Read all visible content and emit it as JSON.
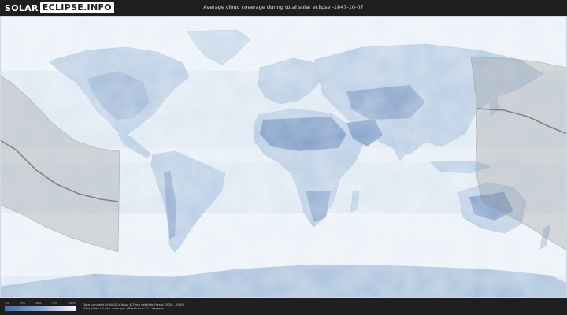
{
  "header": {
    "logo_solar": "SOLAR",
    "logo_eclipse": "ECLIPSE.INFO",
    "title": "Average cloud coverage during total solar eclipse -1847-10-07"
  },
  "legend": {
    "ticks": [
      "0%",
      "25%",
      "50%",
      "75%",
      "100%"
    ],
    "colors": {
      "clear": "#4b6ea6",
      "mid": "#8da6cf",
      "cloudy": "#f4f7fb"
    }
  },
  "credits": {
    "line1": "Data provided by NASA's Aqua & Terra satellite (Years: 2000 - 2019)",
    "line2": "https://neo.sci.gsfc.nasa.gov | Resolution: 0.1 degrees"
  },
  "map": {
    "path_color": "#8a8a8a",
    "centerline_color": "#6f6f6f",
    "ocean_color": "#dde8f3",
    "land_color": "#b9cde4"
  }
}
